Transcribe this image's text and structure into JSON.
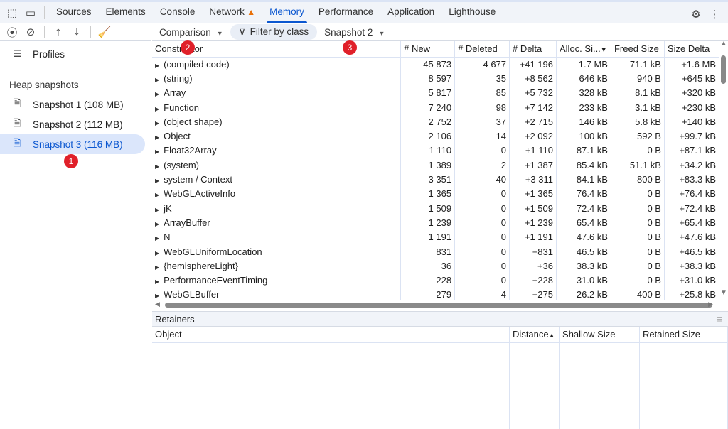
{
  "tabs": [
    {
      "label": "Sources"
    },
    {
      "label": "Elements"
    },
    {
      "label": "Console"
    },
    {
      "label": "Network",
      "warning": true
    },
    {
      "label": "Memory",
      "active": true
    },
    {
      "label": "Performance"
    },
    {
      "label": "Application"
    },
    {
      "label": "Lighthouse"
    }
  ],
  "sidebar": {
    "profiles_label": "Profiles",
    "section_title": "Heap snapshots",
    "snapshots": [
      {
        "label": "Snapshot 1 (108 MB)"
      },
      {
        "label": "Snapshot 2 (112 MB)"
      },
      {
        "label": "Snapshot 3 (116 MB)",
        "selected": true
      }
    ]
  },
  "toolbar": {
    "view_mode": "Comparison",
    "filter_label": "Filter by class",
    "base_snapshot": "Snapshot 2"
  },
  "table": {
    "headers": [
      "Constructor",
      "# New",
      "# Deleted",
      "# Delta",
      "Alloc. Si...",
      "Freed Size",
      "Size Delta"
    ],
    "sort_column": "Alloc. Size",
    "sort_direction": "descending",
    "rows": [
      [
        "(compiled code)",
        "45 873",
        "4 677",
        "+41 196",
        "1.7 MB",
        "71.1 kB",
        "+1.6 MB"
      ],
      [
        "(string)",
        "8 597",
        "35",
        "+8 562",
        "646 kB",
        "940 B",
        "+645 kB"
      ],
      [
        "Array",
        "5 817",
        "85",
        "+5 732",
        "328 kB",
        "8.1 kB",
        "+320 kB"
      ],
      [
        "Function",
        "7 240",
        "98",
        "+7 142",
        "233 kB",
        "3.1 kB",
        "+230 kB"
      ],
      [
        "(object shape)",
        "2 752",
        "37",
        "+2 715",
        "146 kB",
        "5.8 kB",
        "+140 kB"
      ],
      [
        "Object",
        "2 106",
        "14",
        "+2 092",
        "100 kB",
        "592 B",
        "+99.7 kB"
      ],
      [
        "Float32Array",
        "1 110",
        "0",
        "+1 110",
        "87.1 kB",
        "0 B",
        "+87.1 kB"
      ],
      [
        "(system)",
        "1 389",
        "2",
        "+1 387",
        "85.4 kB",
        "51.1 kB",
        "+34.2 kB"
      ],
      [
        "system / Context",
        "3 351",
        "40",
        "+3 311",
        "84.1 kB",
        "800 B",
        "+83.3 kB"
      ],
      [
        "WebGLActiveInfo",
        "1 365",
        "0",
        "+1 365",
        "76.4 kB",
        "0 B",
        "+76.4 kB"
      ],
      [
        "jK",
        "1 509",
        "0",
        "+1 509",
        "72.4 kB",
        "0 B",
        "+72.4 kB"
      ],
      [
        "ArrayBuffer",
        "1 239",
        "0",
        "+1 239",
        "65.4 kB",
        "0 B",
        "+65.4 kB"
      ],
      [
        "N",
        "1 191",
        "0",
        "+1 191",
        "47.6 kB",
        "0 B",
        "+47.6 kB"
      ],
      [
        "WebGLUniformLocation",
        "831",
        "0",
        "+831",
        "46.5 kB",
        "0 B",
        "+46.5 kB"
      ],
      [
        "{hemisphereLight}",
        "36",
        "0",
        "+36",
        "38.3 kB",
        "0 B",
        "+38.3 kB"
      ],
      [
        "PerformanceEventTiming",
        "228",
        "0",
        "+228",
        "31.0 kB",
        "0 B",
        "+31.0 kB"
      ],
      [
        "WebGLBuffer",
        "279",
        "4",
        "+275",
        "26.2 kB",
        "400 B",
        "+25.8 kB"
      ]
    ]
  },
  "retainers": {
    "title": "Retainers",
    "headers": [
      "Object",
      "Distance",
      "Shallow Size",
      "Retained Size"
    ]
  },
  "annotations": [
    "1",
    "2",
    "3"
  ],
  "colors": {
    "accent": "#0b57d0",
    "badge": "#e0202a",
    "warning": "#e8710a"
  }
}
